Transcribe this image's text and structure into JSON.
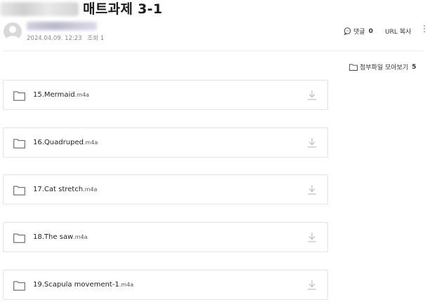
{
  "post": {
    "title": "매트과제 3-1",
    "date": "2024.04.09. 12:23",
    "views_label": "조회 1"
  },
  "actions": {
    "comment_label": "댓글",
    "comment_count": "0",
    "url_copy_label": "URL 복사",
    "more_icon": "⋮"
  },
  "attachments": {
    "view_all_label": "첨부파일 모아보기",
    "count": "5",
    "files": [
      {
        "name": "15.Mermaid",
        "ext": ".m4a"
      },
      {
        "name": "16.Quadruped",
        "ext": ".m4a"
      },
      {
        "name": "17.Cat stretch",
        "ext": ".m4a"
      },
      {
        "name": "18.The saw",
        "ext": ".m4a"
      },
      {
        "name": "19.Scapula movement-1",
        "ext": ".m4a"
      }
    ]
  },
  "icons": {
    "folder": "folder-icon",
    "download": "download-icon",
    "comment": "comment-bubble-icon"
  },
  "colors": {
    "border": "#e3e3e3",
    "meta_text": "#8a8a8a",
    "icon_gray": "#b5b5b5"
  }
}
